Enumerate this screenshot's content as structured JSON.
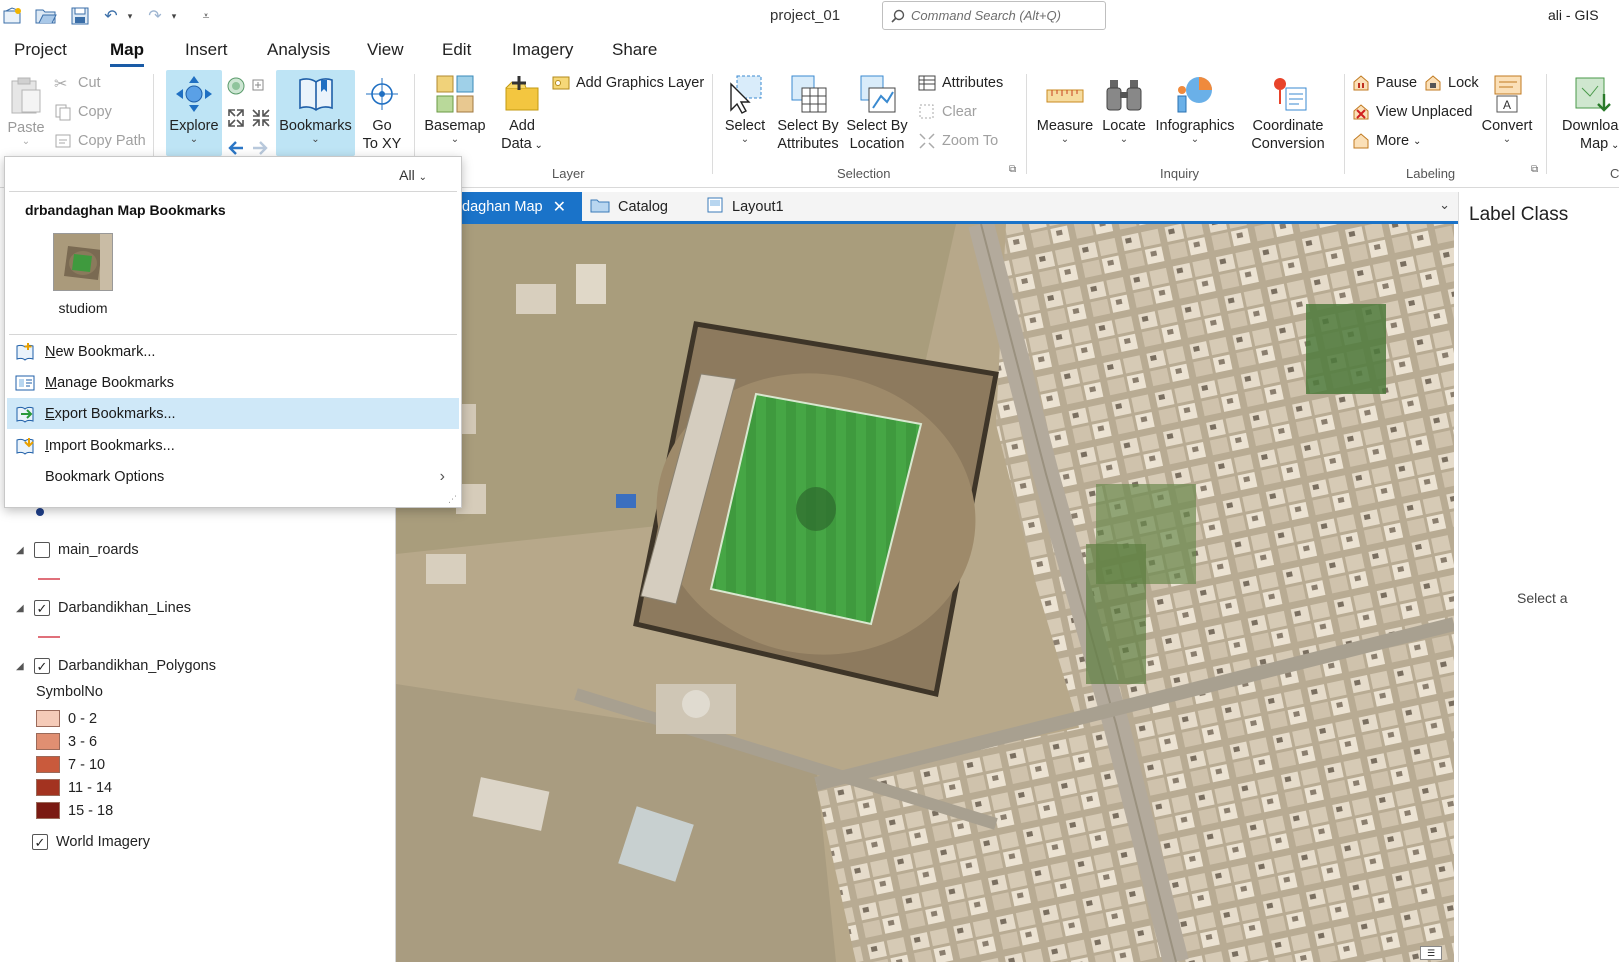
{
  "titlebar": {
    "document": "project_01",
    "search_placeholder": "Command Search (Alt+Q)",
    "user": "ali - GIS"
  },
  "ribbon_tabs": [
    "Project",
    "Map",
    "Insert",
    "Analysis",
    "View",
    "Edit",
    "Imagery",
    "Share"
  ],
  "ribbon": {
    "clipboard": {
      "paste": "Paste",
      "cut": "Cut",
      "copy": "Copy",
      "copy_path": "Copy Path"
    },
    "navigate": {
      "explore": "Explore",
      "bookmarks": "Bookmarks",
      "go_to_xy_1": "Go",
      "go_to_xy_2": "To XY"
    },
    "layer": {
      "basemap": "Basemap",
      "add_data_1": "Add",
      "add_data_2": "Data",
      "add_graphics": "Add Graphics Layer",
      "group": "Layer"
    },
    "selection": {
      "select": "Select",
      "by_attr_1": "Select By",
      "by_attr_2": "Attributes",
      "by_loc_1": "Select By",
      "by_loc_2": "Location",
      "attributes": "Attributes",
      "clear": "Clear",
      "zoom_to": "Zoom To",
      "group": "Selection"
    },
    "inquiry": {
      "measure": "Measure",
      "locate": "Locate",
      "infographics": "Infographics",
      "coord_1": "Coordinate",
      "coord_2": "Conversion",
      "group": "Inquiry"
    },
    "labeling": {
      "pause": "Pause",
      "lock": "Lock",
      "view_unplaced": "View Unplaced",
      "more": "More",
      "convert": "Convert",
      "group": "Labeling"
    },
    "offline": {
      "download_1": "Downloa",
      "download_2": "Map"
    },
    "next_group_initial": "C"
  },
  "view_tabs": [
    {
      "label": "daghan Map",
      "active": true
    },
    {
      "label": "Catalog",
      "active": false
    },
    {
      "label": "Layout1",
      "active": false
    }
  ],
  "right_panel": {
    "title": "Label Class",
    "hint": "Select a"
  },
  "contents": {
    "layers": [
      {
        "name": "main_roards",
        "checked": false
      },
      {
        "name": "Darbandikhan_Lines",
        "checked": true
      },
      {
        "name": "Darbandikhan_Polygons",
        "checked": true
      }
    ],
    "legend_title": "SymbolNo",
    "legend": [
      {
        "label": "0 - 2",
        "color": "#f5cbb8"
      },
      {
        "label": "3 - 6",
        "color": "#e08f72"
      },
      {
        "label": "7 - 10",
        "color": "#c95a3c"
      },
      {
        "label": "11 - 14",
        "color": "#a33320"
      },
      {
        "label": "15 - 18",
        "color": "#7a1a12"
      }
    ],
    "basemap_layer": {
      "name": "World Imagery",
      "checked": true
    }
  },
  "bookmarks_menu": {
    "filter": "All",
    "group_title": "drbandaghan Map Bookmarks",
    "bookmark_name": "studiom",
    "items": [
      {
        "label": "New Bookmark...",
        "underline": "N",
        "rest": "ew Bookmark..."
      },
      {
        "label": "Manage Bookmarks",
        "underline": "M",
        "rest": "anage Bookmarks"
      },
      {
        "label": "Export Bookmarks...",
        "underline": "E",
        "rest": "xport Bookmarks..."
      },
      {
        "label": "Import Bookmarks...",
        "underline": "I",
        "rest": "mport Bookmarks..."
      },
      {
        "label": "Bookmark Options"
      }
    ]
  }
}
